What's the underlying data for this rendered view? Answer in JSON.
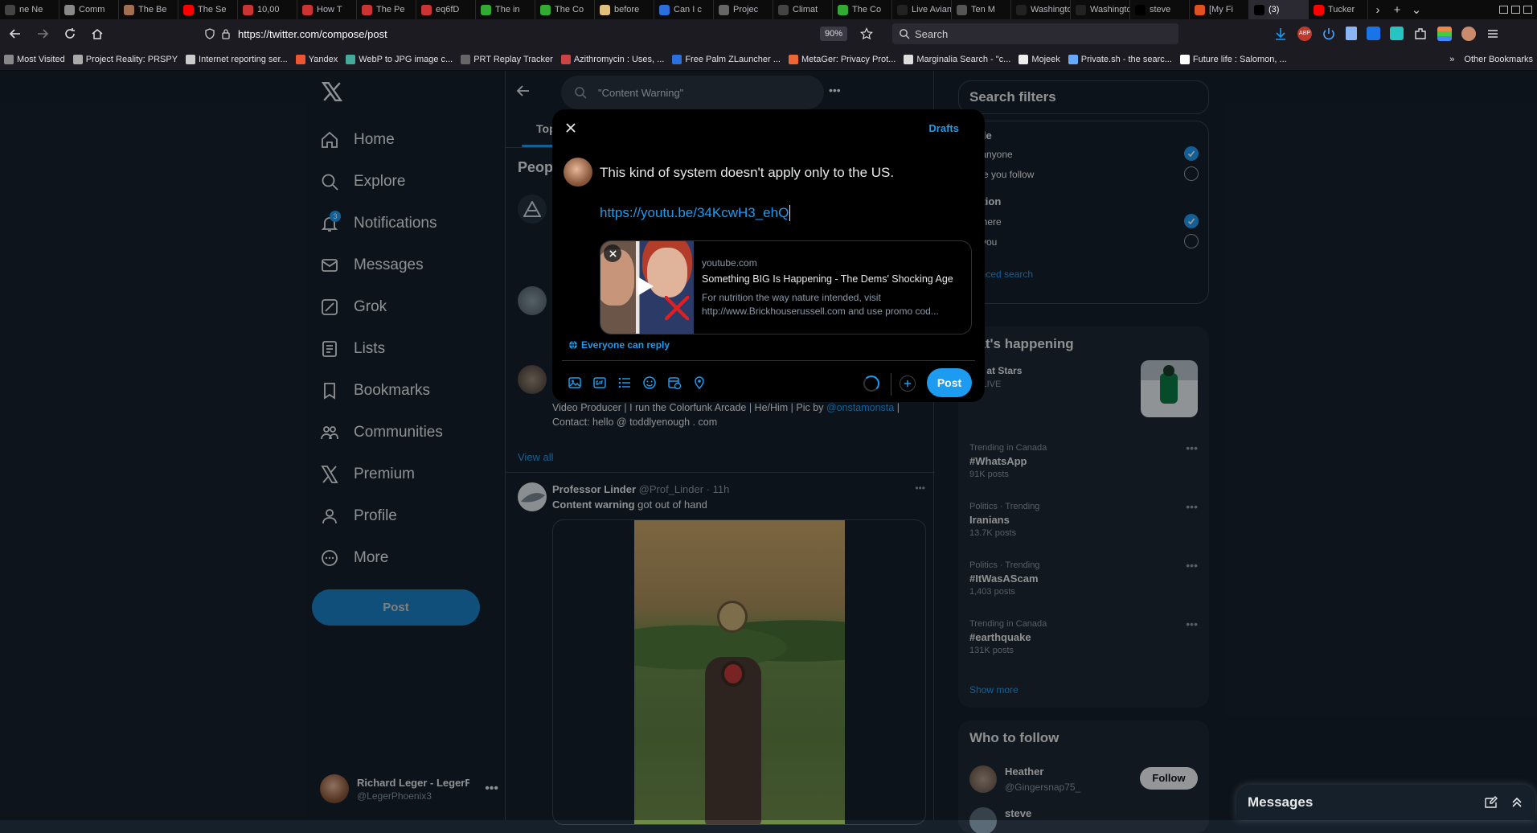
{
  "browser": {
    "tabs": [
      {
        "title": "ne Ne",
        "color": "#444"
      },
      {
        "title": "Comm",
        "color": "#888"
      },
      {
        "title": "The Be",
        "color": "#a07050"
      },
      {
        "title": "The Se",
        "color": "#ff0000"
      },
      {
        "title": "10,00",
        "color": "#cc3333"
      },
      {
        "title": "How T",
        "color": "#cc3333"
      },
      {
        "title": "The Pe",
        "color": "#cc3333"
      },
      {
        "title": "eq6fD",
        "color": "#cc3333"
      },
      {
        "title": "The in",
        "color": "#33aa33"
      },
      {
        "title": "The Co",
        "color": "#33aa33"
      },
      {
        "title": "before",
        "color": "#e0c080"
      },
      {
        "title": "Can I c",
        "color": "#2a6fdb"
      },
      {
        "title": "Projec",
        "color": "#666"
      },
      {
        "title": "Climat",
        "color": "#444"
      },
      {
        "title": "The Co",
        "color": "#33aa33"
      },
      {
        "title": "Live Avian I",
        "color": "#222"
      },
      {
        "title": "Ten M",
        "color": "#555"
      },
      {
        "title": "Washingtor",
        "color": "#222"
      },
      {
        "title": "Washingtor",
        "color": "#222"
      },
      {
        "title": "steve",
        "color": "#000"
      },
      {
        "title": "[My Fi",
        "color": "#e05020"
      },
      {
        "title": "(3)",
        "color": "#000"
      },
      {
        "title": "Tucker",
        "color": "#ff0000"
      }
    ],
    "active_tab": 21,
    "url": "https://twitter.com/compose/post",
    "zoom": "90%",
    "search_placeholder": "Search",
    "bookmarks": [
      "Most Visited",
      "Project Reality: PRSPY",
      "Internet reporting ser...",
      "Yandex",
      "WebP to JPG image c...",
      "PRT Replay Tracker",
      "Azithromycin : Uses, ...",
      "Free Palm ZLauncher ...",
      "MetaGer: Privacy Prot...",
      "Marginalia Search - \"c...",
      "Mojeek",
      "Private.sh - the searc...",
      "Future life : Salomon, ..."
    ],
    "other_bookmarks": "Other Bookmarks"
  },
  "nav": {
    "items": [
      "Home",
      "Explore",
      "Notifications",
      "Messages",
      "Grok",
      "Lists",
      "Bookmarks",
      "Communities",
      "Premium",
      "Profile",
      "More"
    ],
    "notifications_badge": "3",
    "post_label": "Post",
    "profile_name": "Richard Leger - LegerF",
    "profile_handle": "@LegerPhoenix3"
  },
  "search": {
    "query": "\"Content Warning\"",
    "tab_partial": "Top",
    "people_partial": "Peop",
    "bio_text": "Video Producer | I run the Colorfunk Arcade | He/Him | Pic by",
    "bio_mention": "@onstamonsta",
    "bio_end": "|",
    "bio_contact": "Contact: hello @ toddlyenough . com",
    "view_all": "View all"
  },
  "tweet": {
    "name": "Professor Linder",
    "handle": "@Prof_Linder",
    "time": "11h",
    "text_bold": "Content warning",
    "text_rest": " got out of hand"
  },
  "compose": {
    "drafts": "Drafts",
    "text": "This kind of system doesn't apply only to the US.",
    "link": "https://youtu.be/34KcwH3_ehQ",
    "card_domain": "youtube.com",
    "card_title": "Something BIG Is Happening - The Dems' Shocking Age",
    "card_desc": "For nutrition the way nature intended, visit http://www.Brickhouserussell.com and use promo cod...",
    "reply_setting": "Everyone can reply",
    "post_label": "Post"
  },
  "filters": {
    "title": "Search filters",
    "people_header": "ople",
    "opt_anyone": "m anyone",
    "opt_follow": "ople you follow",
    "location_header": "cation",
    "opt_anywhere": "ywhere",
    "opt_near": "ar you",
    "advanced": "vanced search"
  },
  "happening": {
    "title": "hat's happening",
    "event_title": "ers at Stars",
    "event_meta": "L · LIVE",
    "trends": [
      {
        "meta": "Trending in Canada",
        "name": "#WhatsApp",
        "count": "91K posts"
      },
      {
        "meta": "Politics · Trending",
        "name": "Iranians",
        "count": "13.7K posts"
      },
      {
        "meta": "Politics · Trending",
        "name": "#ItWasAScam",
        "count": "1,403 posts"
      },
      {
        "meta": "Trending in Canada",
        "name": "#earthquake",
        "count": "131K posts"
      }
    ],
    "show_more": "Show more"
  },
  "who_to_follow": {
    "title": "Who to follow",
    "name": "Heather",
    "handle": "@Gingersnap75_",
    "follow_label": "Follow",
    "next_partial": "steve"
  },
  "messages_label": "Messages",
  "colors": {
    "accent": "#1d9bf0",
    "bg": "#15202b",
    "panel": "#1e2732"
  }
}
